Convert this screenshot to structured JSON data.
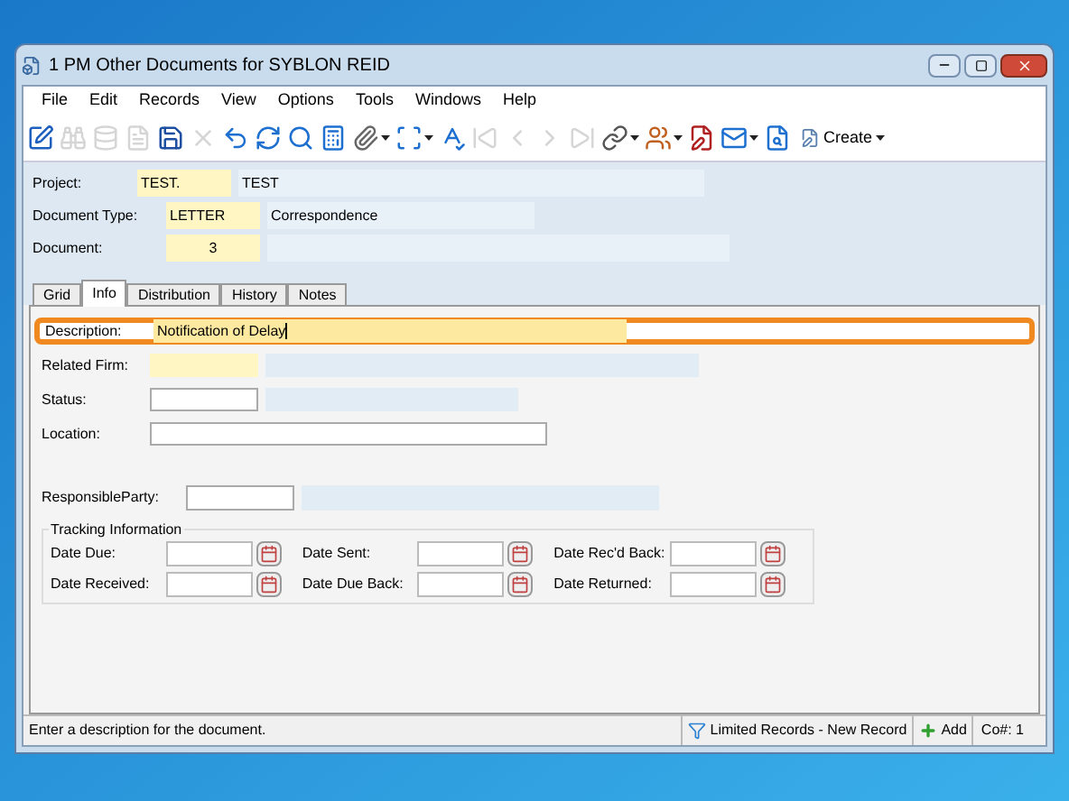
{
  "window": {
    "title": "1 PM Other Documents for SYBLON REID"
  },
  "menu": [
    "File",
    "Edit",
    "Records",
    "View",
    "Options",
    "Tools",
    "Windows",
    "Help"
  ],
  "toolbar": [
    {
      "disabled": false,
      "dropdown": false
    },
    {
      "disabled": true,
      "dropdown": false
    },
    {
      "disabled": true,
      "dropdown": false
    },
    {
      "disabled": true,
      "dropdown": false
    },
    {
      "disabled": false,
      "dropdown": false
    },
    {
      "disabled": true,
      "dropdown": false
    },
    {
      "disabled": false,
      "dropdown": false
    },
    {
      "disabled": false,
      "dropdown": false
    },
    {
      "disabled": false,
      "dropdown": false
    },
    {
      "disabled": false,
      "dropdown": false
    },
    {
      "disabled": false,
      "dropdown": true
    },
    {
      "disabled": false,
      "dropdown": true
    },
    {
      "disabled": false,
      "dropdown": false
    },
    {
      "disabled": true,
      "dropdown": false
    },
    {
      "disabled": true,
      "dropdown": false
    },
    {
      "disabled": true,
      "dropdown": false
    },
    {
      "disabled": true,
      "dropdown": false
    },
    {
      "disabled": false,
      "dropdown": true
    },
    {
      "disabled": false,
      "dropdown": true
    },
    {
      "disabled": false,
      "dropdown": false
    },
    {
      "disabled": false,
      "dropdown": true
    },
    {
      "disabled": false,
      "dropdown": false
    }
  ],
  "create_button": "Create",
  "header": [
    {
      "label": "Project:",
      "code": "TEST.",
      "description": "TEST"
    },
    {
      "label": "Document Type:",
      "code": "LETTER",
      "description": "Correspondence"
    },
    {
      "label": "Document:",
      "code": "3"
    }
  ],
  "tabs": [
    {
      "label": "Grid",
      "selected": false
    },
    {
      "label": "Info",
      "selected": true
    },
    {
      "label": "Distribution",
      "selected": false
    },
    {
      "label": "History",
      "selected": false
    },
    {
      "label": "Notes",
      "selected": false
    }
  ],
  "fields": [
    {
      "kind": "wide",
      "label": "Description:",
      "value": "Notification of Delay",
      "highlighted": true
    },
    {
      "kind": "lookup",
      "label": "Related Firm:",
      "required": true,
      "highlighted": false
    },
    {
      "kind": "lookup",
      "label": "Status:",
      "required": false,
      "highlighted": false
    },
    {
      "kind": "text",
      "label": "Location:",
      "highlighted": false
    }
  ],
  "responsible_party": {
    "label": "ResponsibleParty:"
  },
  "tracking": {
    "title": "Tracking Information",
    "dates": [
      {
        "label": "Date Due:"
      },
      {
        "label": "Date Sent:"
      },
      {
        "label": "Date Rec'd Back:"
      },
      {
        "label": "Date Received:"
      },
      {
        "label": "Date Due Back:"
      },
      {
        "label": "Date Returned:"
      }
    ]
  },
  "status_bar": {
    "message": "Enter a description for the document.",
    "records": "Limited Records - New Record",
    "add": "Add",
    "company": "Co#: 1"
  }
}
